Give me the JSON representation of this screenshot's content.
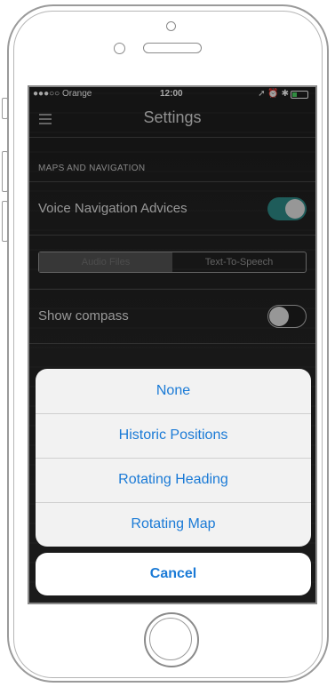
{
  "status_bar": {
    "carrier": "●●●○○ Orange",
    "time": "12:00",
    "right_icons": "➚ ⏰ ✱",
    "battery_level": 0.3
  },
  "nav": {
    "title": "Settings",
    "menu_icon": "hamburger-icon"
  },
  "section": {
    "header": "MAPS AND NAVIGATION"
  },
  "rows": {
    "voice_navigation": {
      "label": "Voice Navigation Advices",
      "toggle_on": true
    },
    "show_compass": {
      "label": "Show compass",
      "toggle_on": false
    }
  },
  "segmented": {
    "options": [
      "Audio Files",
      "Text-To-Speech"
    ],
    "selected": "Audio Files"
  },
  "action_sheet": {
    "options": [
      "None",
      "Historic Positions",
      "Rotating Heading",
      "Rotating Map"
    ],
    "cancel": "Cancel"
  },
  "colors": {
    "accent": "#1a7ad6",
    "toggle_on": "#2f8e8a",
    "battery": "#4cd964"
  }
}
